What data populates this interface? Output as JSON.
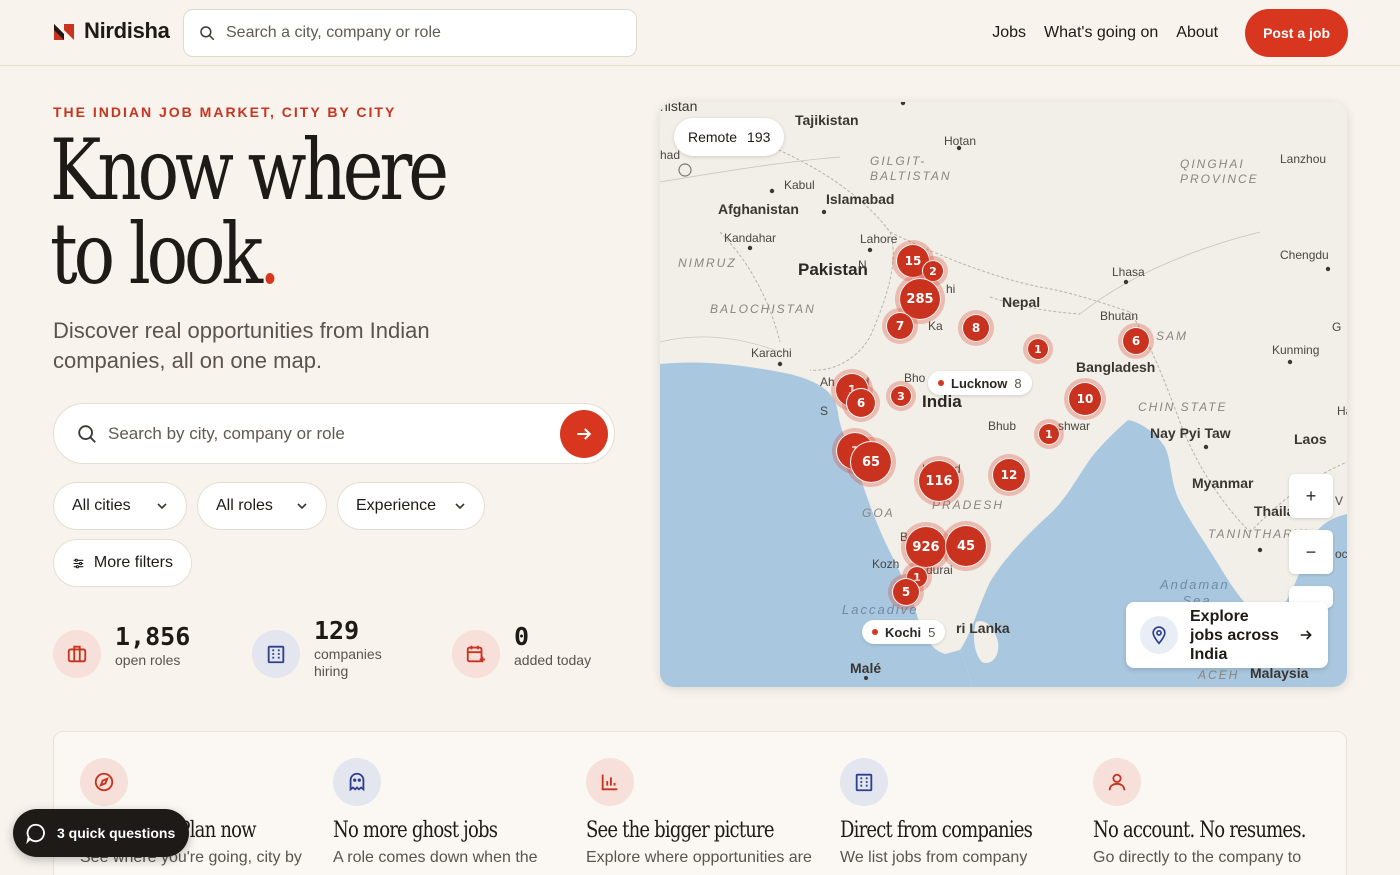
{
  "brand": {
    "name": "Nirdisha"
  },
  "header": {
    "search_placeholder": "Search a city, company or role",
    "nav": [
      "Jobs",
      "What's going on",
      "About"
    ],
    "cta": "Post a job"
  },
  "hero": {
    "eyebrow": "THE INDIAN JOB MARKET, CITY BY CITY",
    "headline_line1": "Know where",
    "headline_line2": "to look",
    "headline_dot": ".",
    "subtitle": "Discover real opportunities from Indian companies, all on one map.",
    "search_placeholder": "Search by city, company or role"
  },
  "filters": {
    "cities": "All cities",
    "roles": "All roles",
    "experience": "Experience",
    "more": "More filters"
  },
  "stats": [
    {
      "value": "1,856",
      "caption": "open roles",
      "icon": "briefcase-icon",
      "color": "#f6e0d9"
    },
    {
      "value": "129",
      "caption": "companies hiring",
      "icon": "building-icon",
      "color": "#e3e6ef"
    },
    {
      "value": "0",
      "caption": "added today",
      "icon": "calendar-plus-icon",
      "color": "#f6e0d9"
    }
  ],
  "map": {
    "remote_label": "Remote",
    "remote_count": "193",
    "countries": [
      "Tajikistan",
      "Afghanistan",
      "Pakistan",
      "Nepal",
      "Bhutan",
      "Bangladesh",
      "India",
      "Myanmar",
      "Thailand",
      "Laos",
      "Sri Lanka",
      "Malaysia"
    ],
    "cities": [
      "Hotan",
      "Kabul",
      "Islamabad",
      "Kandahar",
      "Lahore",
      "Lhasa",
      "Chengdu",
      "Kunming",
      "Karachi",
      "Nay Pyi Taw",
      "Malé"
    ],
    "regions": [
      "GILGIT-BALTISTAN",
      "QINGHAI PROVINCE",
      "NIMRUZ",
      "BALOCHISTAN",
      "CHIN STATE",
      "GOA",
      "PRADESH",
      "Laccadive",
      "Andaman Sea",
      "TANINTHARYI",
      "ACEH"
    ],
    "clusters": [
      {
        "label": "15",
        "size": "md"
      },
      {
        "label": "2",
        "size": "sm"
      },
      {
        "label": "285",
        "size": "lg"
      },
      {
        "label": "7",
        "size": "md"
      },
      {
        "label": "8",
        "size": "md"
      },
      {
        "label": "1",
        "size": "sm"
      },
      {
        "label": "6",
        "size": "md"
      },
      {
        "label": "10",
        "size": "md"
      },
      {
        "label": "3",
        "size": "sm"
      },
      {
        "label": "1",
        "size": "sm"
      },
      {
        "label": "6",
        "size": "md"
      },
      {
        "label": "1",
        "size": "md"
      },
      {
        "label": "65",
        "size": "lg"
      },
      {
        "label": "116",
        "size": "lg"
      },
      {
        "label": "12",
        "size": "md"
      },
      {
        "label": "926",
        "size": "lg"
      },
      {
        "label": "45",
        "size": "lg"
      },
      {
        "label": "1",
        "size": "sm"
      },
      {
        "label": "5",
        "size": "md"
      },
      {
        "label": "1",
        "size": "md"
      }
    ],
    "city_chips": [
      {
        "name": "Lucknow",
        "count": "8"
      },
      {
        "name": "Kochi",
        "count": "5"
      }
    ],
    "zoom_in": "+",
    "zoom_out": "−",
    "explore": "Explore jobs across India"
  },
  "features": [
    {
      "title": "Plan now",
      "desc": "See where you're going, city by",
      "icon": "compass-icon",
      "color": "#f6e0d9"
    },
    {
      "title": "No more ghost jobs",
      "desc": "A role comes down when the",
      "icon": "ghost-icon",
      "color": "#e3e6ef"
    },
    {
      "title": "See the bigger picture",
      "desc": "Explore where opportunities are",
      "icon": "bar-chart-icon",
      "color": "#f6e0d9"
    },
    {
      "title": "Direct from companies",
      "desc": "We list jobs from company",
      "icon": "building-icon",
      "color": "#e3e6ef"
    },
    {
      "title": "No account. No resumes.",
      "desc": "Go directly to the company to",
      "icon": "user-icon",
      "color": "#f6e0d9"
    }
  ],
  "quick_questions": "3 quick questions",
  "colors": {
    "accent": "#d9361f",
    "background": "#f8f3ec",
    "water": "#a9c8e0",
    "land": "#f2efe8"
  }
}
